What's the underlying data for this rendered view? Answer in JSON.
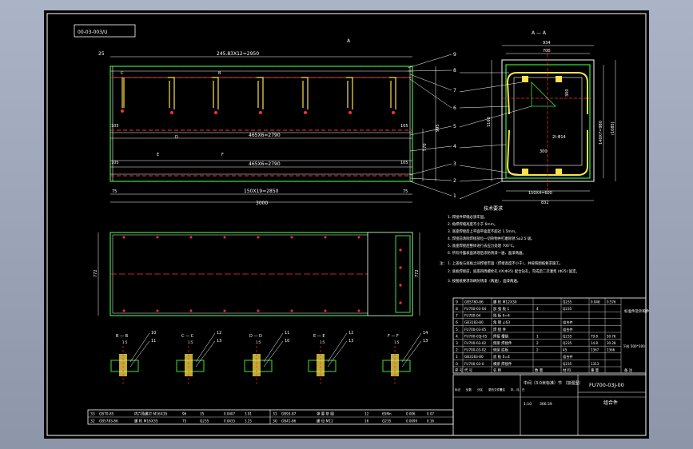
{
  "drawing": {
    "frame_tag": "00-03-003/U",
    "section_a_top": "A",
    "section_a_label": "A — A",
    "section_b": "B",
    "section_c": "C",
    "section_d": "D",
    "section_e": "E",
    "section_f": "F",
    "dim_top_overall": "245.83X12=2950",
    "dim_mid_1": "465X6=2790",
    "dim_mid_2": "465X6=2790",
    "dim_bottom_1": "150X19=2850",
    "dim_bottom_2": "3000",
    "dim_left_25": "25",
    "dim_105_a": "105",
    "dim_105_b": "105",
    "dim_105_c": "105",
    "dim_105_d": "105",
    "dim_75_a": "75",
    "dim_75_b": "75",
    "dim_570": "570",
    "dim_995": "995",
    "dim_772_left": "772",
    "dim_772_right": "772",
    "sec_dim_934": "934",
    "sec_dim_700": "700",
    "sec_dim_1160": "1160",
    "sec_dim_300_a": "300",
    "sec_dim_300_b": "300",
    "sec_dim_right_1": "140X7=980",
    "sec_dim_right_2": "(1085)",
    "sec_dim_phi": "2I-Φ14",
    "sec_dim_150": "150X4=600",
    "sec_dim_832": "832",
    "callouts": [
      "9",
      "8",
      "7",
      "6",
      "5",
      "4",
      "3",
      "2",
      "1"
    ],
    "sec_callouts": [
      "8",
      "7",
      "6",
      "5",
      "4",
      "3",
      "2",
      "1"
    ],
    "notes_title": "技术要求",
    "notes": [
      "1. 焊接件焊缝必须牢固。",
      "2. 角焊焊缝高度不小于 6mm。",
      "3. 底座焊接后上平面平面度不超过 1.5mm。",
      "4. 焊接前清除焊接部位一切杂物并打磨除锈 Sa2.5 级。",
      "5. 底座焊接后整体进行去应力处理 700℃。",
      "6. 所有外露表面清理后涂防锈漆一遍、面漆两遍。"
    ],
    "notes2": [
      "注： 1. 上盖板与底板之间焊接牢固（焊接高度不小于），并按照图纸要求施工。",
      "2. 底板焊接前，底座四周螺栓孔 4X(Φ35) 配合钻孔，完成后二次灌浆 (Φ25) 固定。",
      "3. 按图纸要求涂刷防锈漆（两遍），面漆两遍。"
    ],
    "section_details": [
      {
        "label": "B — B",
        "scale": "1:5",
        "calls": [
          "10",
          "11"
        ]
      },
      {
        "label": "C — C",
        "scale": "1:5",
        "calls": [
          "12",
          "13"
        ]
      },
      {
        "label": "D — D",
        "scale": "1:5",
        "calls": [
          "11",
          "10"
        ]
      },
      {
        "label": "E — E",
        "scale": "1:5",
        "calls": [
          "12",
          "13"
        ]
      },
      {
        "label": "F — F",
        "scale": "1:5",
        "calls": [
          "14",
          "13"
        ]
      }
    ],
    "bom_rows": [
      {
        "no": "9",
        "code": "GB5780-86",
        "name": "螺 栓 M12X30",
        "qty": "",
        "mat": "Q235",
        "w1": "0.048",
        "w2": "0.576"
      },
      {
        "no": "8",
        "code": "FU700-03-04",
        "name": "加 强 板 1",
        "qty": "4",
        "mat": "Q235",
        "w1": "",
        "w2": ""
      },
      {
        "no": "7",
        "code": "FU700-04",
        "name": "挡 板 δ=4",
        "qty": "",
        "mat": "",
        "w1": "",
        "w2": ""
      },
      {
        "no": "6",
        "code": "GB3183-80",
        "name": "角 钢 ∠63",
        "qty": "",
        "mat": "组合件",
        "w1": "",
        "w2": ""
      },
      {
        "no": "5",
        "code": "FU700-03-05",
        "name": "焊 接 件",
        "qty": "",
        "mat": "组合件",
        "w1": "",
        "w2": ""
      },
      {
        "no": "4",
        "code": "FU700-03J-05",
        "name": "焊接 槽钢",
        "qty": "1",
        "mat": "Q235",
        "w1": "79.8",
        "w2": "50.76"
      },
      {
        "no": "3",
        "code": "FU700-03-02",
        "name": "侧梁 焊接件",
        "qty": "2",
        "mat": "Q235",
        "w1": "14.8",
        "w2": "30.28"
      },
      {
        "no": "2",
        "code": "FU700-03-02",
        "name": "侧梁 底板",
        "qty": "2",
        "mat": "45",
        "w1": "1367",
        "w2": "1366"
      },
      {
        "no": "1",
        "code": "GB3183-80",
        "name": "底 板 δ=4",
        "qty": "",
        "mat": "组合件",
        "w1": "",
        "w2": ""
      },
      {
        "no": "0",
        "code": "FU700-03-0",
        "name": "横梁 焊接件",
        "qty": "",
        "mat": "Q235",
        "w1": "1313",
        "w2": ""
      }
    ],
    "bom_side": "标准件及外购件",
    "bom_side2": "下料 500*300",
    "bom_header": {
      "no": "序 号",
      "code": "代 号",
      "name": "名 称",
      "qty": "数 量",
      "mat": "材 料",
      "w": "重 量",
      "remark": "备 注"
    },
    "title_name": "中间（3.0米标准）节\n（加强型）",
    "title_code": "FU700-03J-00",
    "title_type": "组合件",
    "title_small": [
      "标记",
      "处数",
      "分区",
      "更改文件号",
      "签名",
      "年、月、日"
    ],
    "title_scale": "1:10",
    "title_weight": "366.59",
    "bottom_rows": [
      {
        "no": "33",
        "code": "GB70-85",
        "name": "内六角螺钉",
        "extra": "M16X35",
        "qty": "96",
        "mat": "35",
        "w1": "0.0407",
        "w2": "3.91"
      },
      {
        "no": "32",
        "code": "GB5783-86",
        "name": "螺 栓 M16X35",
        "qty": "75",
        "mat": "Q235",
        "w1": "0.0433",
        "w2": "3.25"
      },
      {
        "no": "31",
        "code": "GB93-87",
        "name": "弹 簧 垫 圈",
        "qty": "12",
        "mat": "65Mn",
        "w1": "0.006",
        "w2": "0.07"
      },
      {
        "no": "30",
        "code": "GB41-86",
        "name": "螺 母 M12",
        "qty": "16",
        "mat": "Q235",
        "w1": "0.0099",
        "w2": "0.16"
      }
    ]
  }
}
